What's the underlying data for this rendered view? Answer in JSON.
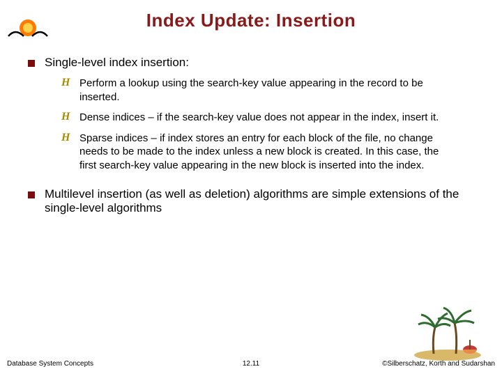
{
  "title": "Index Update:  Insertion",
  "bullets": [
    {
      "text": "Single-level index insertion:",
      "subs": [
        "Perform a lookup using the search-key value appearing in the record to be inserted.",
        "Dense indices – if the search-key value does not appear in the index, insert it.",
        "Sparse indices – if index stores an entry for each block of the file, no change needs to be made to the index unless a new block is created. In this case, the first search-key value appearing in the new block is inserted into the index."
      ]
    },
    {
      "text": "Multilevel insertion (as well as deletion) algorithms are simple extensions of the single-level algorithms",
      "subs": []
    }
  ],
  "footer": {
    "left": "Database System Concepts",
    "center": "12.11",
    "right": "©Silberschatz, Korth and Sudarshan"
  }
}
